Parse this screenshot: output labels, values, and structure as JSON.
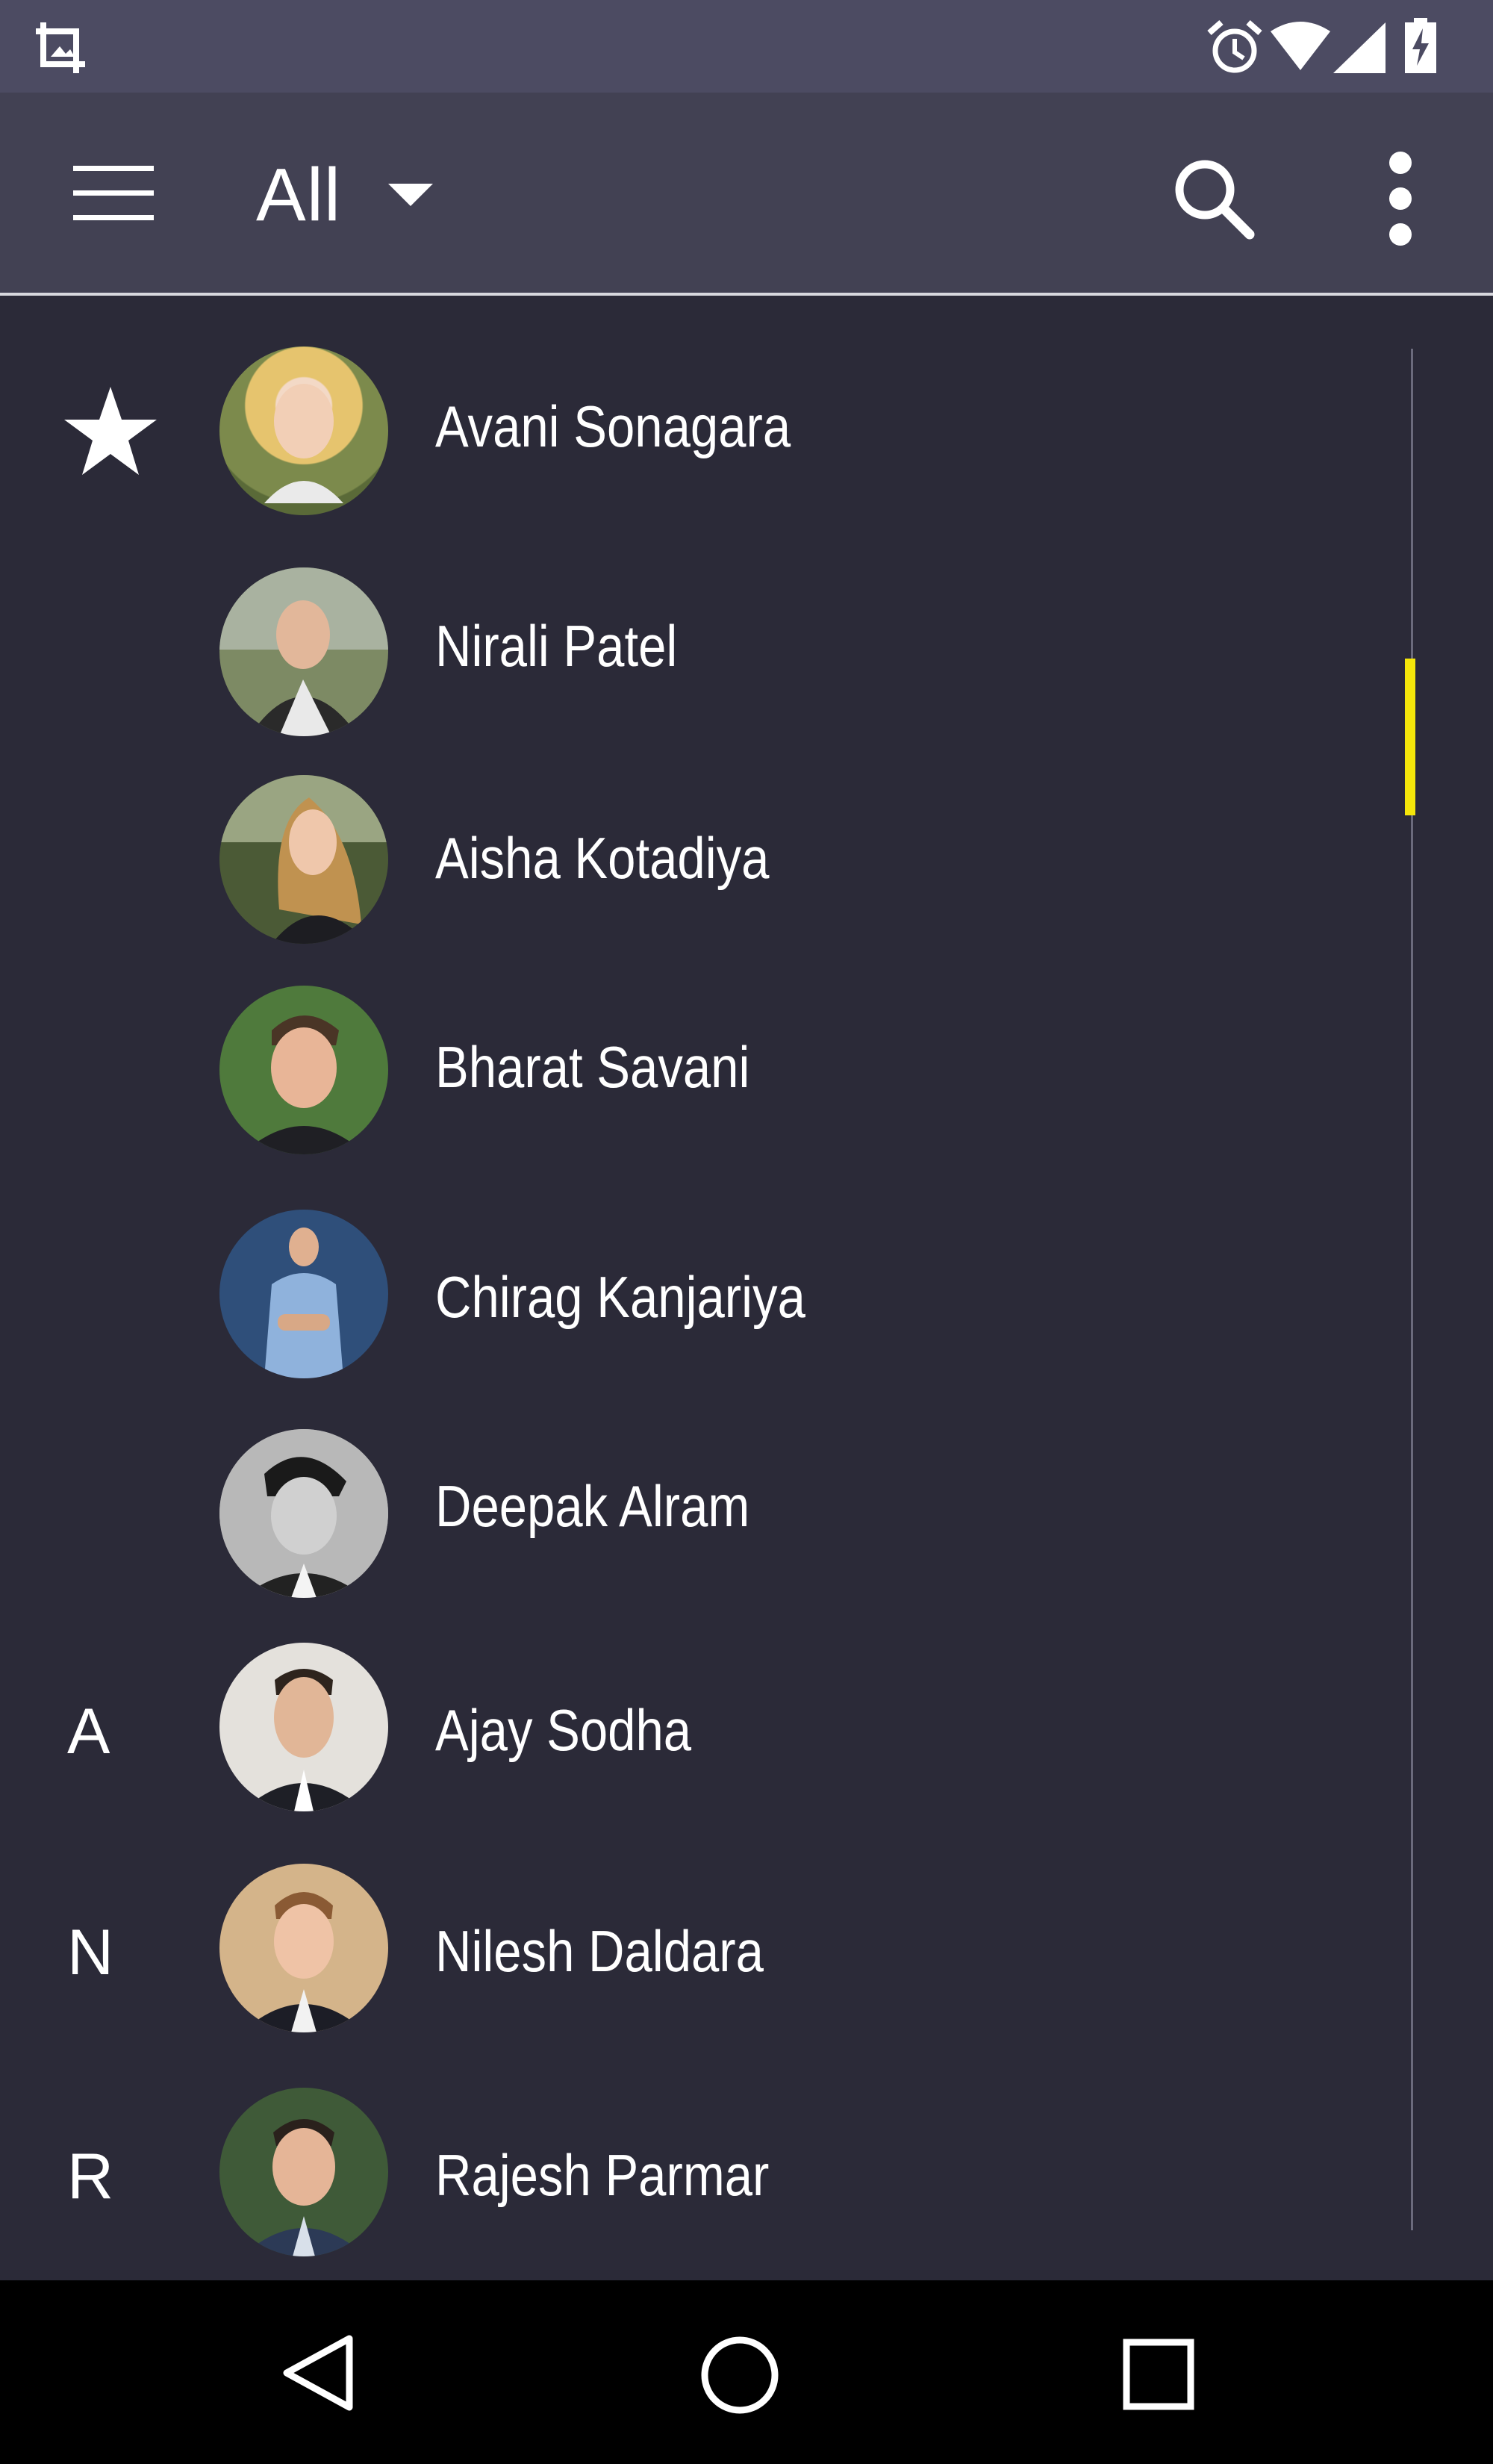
{
  "toolbar": {
    "filter_label": "All"
  },
  "sections": {
    "favorites_icon": "star-icon",
    "letters": [
      "A",
      "N",
      "R"
    ]
  },
  "contacts": [
    {
      "name": "Avani Sonagara"
    },
    {
      "name": "Nirali Patel"
    },
    {
      "name": "Aisha Kotadiya"
    },
    {
      "name": "Bharat Savani"
    },
    {
      "name": "Chirag Kanjariya"
    },
    {
      "name": "Deepak Alram"
    },
    {
      "name": "Ajay Sodha"
    },
    {
      "name": "Nilesh Daldara"
    },
    {
      "name": "Rajesh Parmar"
    }
  ],
  "colors": {
    "status_bar": "#4c4b62",
    "toolbar": "#424153",
    "background": "#2b2a38",
    "scroll_thumb": "#f5e60a",
    "nav_bar": "#000000"
  }
}
